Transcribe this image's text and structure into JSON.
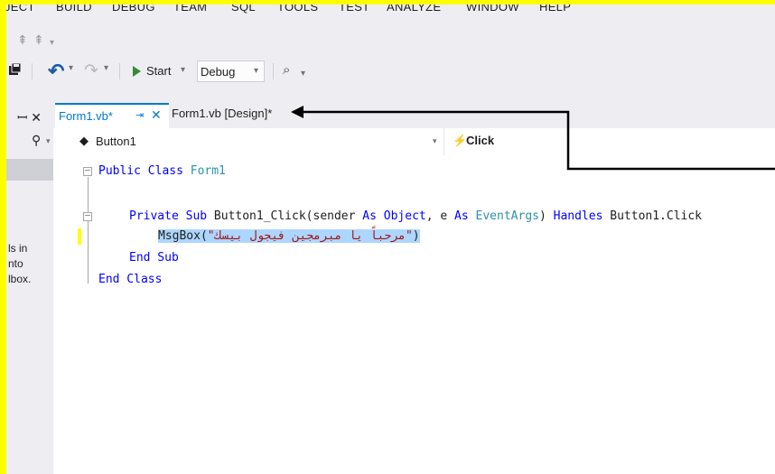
{
  "menu": {
    "items": [
      "JECT",
      "BUILD",
      "DEBUG",
      "TEAM",
      "SQL",
      "TOOLS",
      "TEST",
      "ANALYZE",
      "WINDOW",
      "HELP"
    ]
  },
  "toolbar": {
    "start_label": "Start",
    "config_value": "Debug"
  },
  "left_panel": {
    "pin_close": "ᵖ X",
    "note_lines": [
      "ls in",
      "nto",
      "lbox."
    ]
  },
  "tabs": [
    {
      "label": "Form1.vb*",
      "active": true
    },
    {
      "label": "Form1.vb [Design]*",
      "active": false
    }
  ],
  "navbar": {
    "object": "Button1",
    "event": "Click"
  },
  "code": {
    "line1": {
      "collapse": "−",
      "kw": "Public Class",
      "name": " Form1"
    },
    "line2": {
      "kw1": "Private Sub",
      "name": " Button1_Click(sender ",
      "kw2": "As",
      "kw3": "Object",
      "p1": ", e ",
      "kw4": "As",
      "ty": "EventArgs",
      "p2": ") ",
      "kw5": "Handles",
      "p3": " Button1.Click"
    },
    "line3": {
      "call": "MsgBox(",
      "str": "\"مرحباً يا مبرمجين فيجول بيسك\"",
      "close": ")"
    },
    "line4": {
      "kw": "End Sub"
    },
    "line5": {
      "kw": "End Class"
    }
  },
  "colors": {
    "accent": "#007acc",
    "highlight": "#ffff00",
    "keyword": "#0000ff",
    "type": "#2b91af",
    "string": "#a31515",
    "selection": "#add6ff"
  }
}
